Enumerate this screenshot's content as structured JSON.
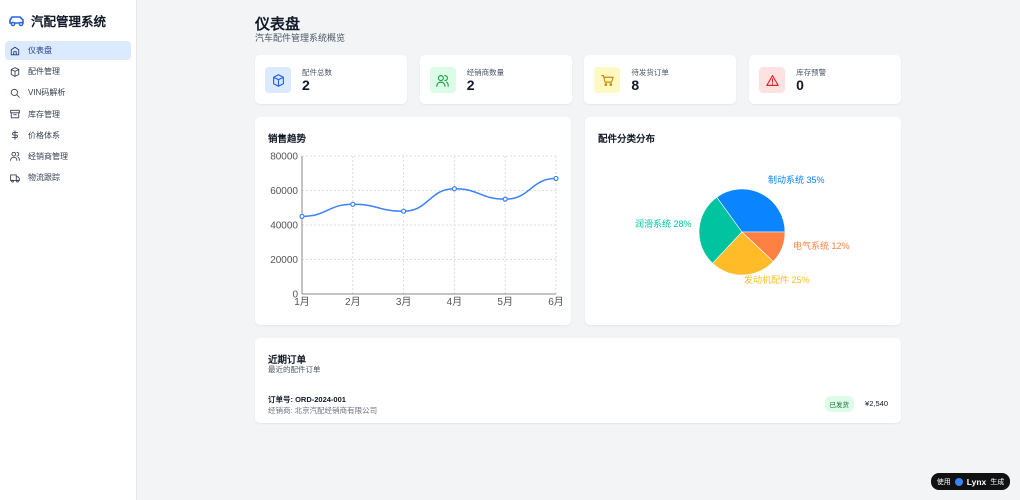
{
  "app": {
    "title": "汽配管理系统",
    "logo_icon": "car-icon"
  },
  "sidebar": {
    "items": [
      {
        "label": "仪表盘",
        "icon": "home-icon",
        "active": true
      },
      {
        "label": "配件管理",
        "icon": "package-icon"
      },
      {
        "label": "VIN码解析",
        "icon": "search-icon"
      },
      {
        "label": "库存管理",
        "icon": "archive-icon"
      },
      {
        "label": "价格体系",
        "icon": "dollar-icon"
      },
      {
        "label": "经销商管理",
        "icon": "users-icon"
      },
      {
        "label": "物流跟踪",
        "icon": "truck-icon"
      }
    ]
  },
  "header": {
    "title": "仪表盘",
    "subtitle": "汽车配件管理系统概览"
  },
  "stats": [
    {
      "label": "配件总数",
      "value": "2",
      "icon": "package-icon",
      "color": "#2563eb",
      "bg": "#dbeafe"
    },
    {
      "label": "经销商数量",
      "value": "2",
      "icon": "users-icon",
      "color": "#16a34a",
      "bg": "#dcfce7"
    },
    {
      "label": "待发货订单",
      "value": "8",
      "icon": "cart-icon",
      "color": "#ca8a04",
      "bg": "#fef9c3"
    },
    {
      "label": "库存预警",
      "value": "0",
      "icon": "alert-icon",
      "color": "#dc2626",
      "bg": "#fee2e2"
    }
  ],
  "sales": {
    "title": "销售趋势"
  },
  "dist": {
    "title": "配件分类分布"
  },
  "chart_data": [
    {
      "type": "line",
      "title": "销售趋势",
      "categories": [
        "1月",
        "2月",
        "3月",
        "4月",
        "5月",
        "6月"
      ],
      "values": [
        45000,
        52000,
        48000,
        61000,
        55000,
        67000
      ],
      "ylim": [
        0,
        80000
      ],
      "yticks": [
        "0",
        "20000",
        "40000",
        "60000",
        "80000"
      ],
      "grid": true,
      "color": "#3b82f6"
    },
    {
      "type": "pie",
      "title": "配件分类分布",
      "slices": [
        {
          "name": "制动系统",
          "value": 35,
          "label": "制动系统 35%",
          "color": "#0a84ff"
        },
        {
          "name": "润滑系统",
          "value": 28,
          "label": "润滑系统 28%",
          "color": "#00c49f"
        },
        {
          "name": "发动机配件",
          "value": 25,
          "label": "发动机配件 25%",
          "color": "#ffbb28"
        },
        {
          "name": "电气系统",
          "value": 12,
          "label": "电气系统 12%",
          "color": "#ff8042"
        }
      ]
    }
  ],
  "orders": {
    "title": "近期订单",
    "subtitle": "最近的配件订单",
    "items": [
      {
        "id": "订单号: ORD-2024-001",
        "dealer": "经销商: 北京汽配经销商有限公司",
        "status": "已发货",
        "amount": "¥2,540"
      }
    ]
  },
  "badge": {
    "prefix": "使用",
    "brand": "Lynx",
    "suffix": "生成"
  }
}
